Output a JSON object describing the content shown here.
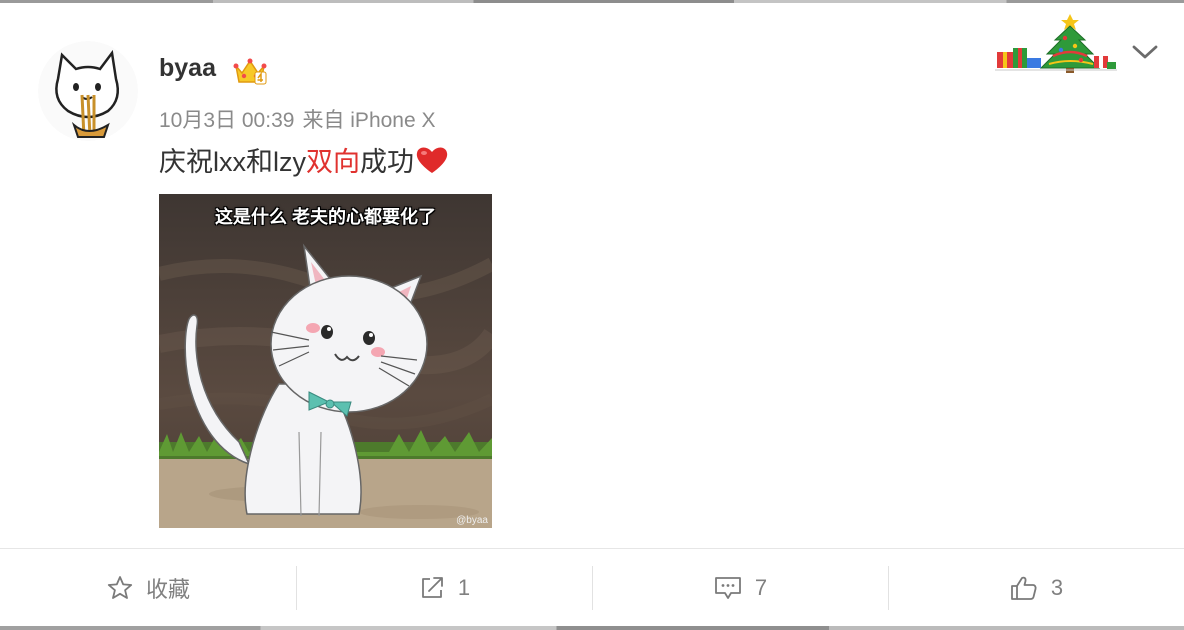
{
  "post": {
    "username": "byaa",
    "date": "10月3日 00:39",
    "source": "来自 iPhone X",
    "text_before": "庆祝lxx和lzy",
    "text_highlight": "双向",
    "text_after": "成功",
    "image_caption": "这是什么 老夫的心都要化了",
    "image_watermark": "@byaa"
  },
  "actions": {
    "favorite_label": "收藏",
    "repost_count": "1",
    "comment_count": "7",
    "like_count": "3"
  },
  "icons": {
    "avatar": "cat-eating-noodles-avatar",
    "badge": "vip-crown-icon",
    "emoji": "red-heart-icon",
    "decoration": "christmas-tree-decoration",
    "menu": "chevron-down-icon"
  },
  "colors": {
    "highlight": "#e0322f",
    "heart": "#e02a2a",
    "meta_text": "#8a8a8a",
    "action_text": "#808080"
  }
}
